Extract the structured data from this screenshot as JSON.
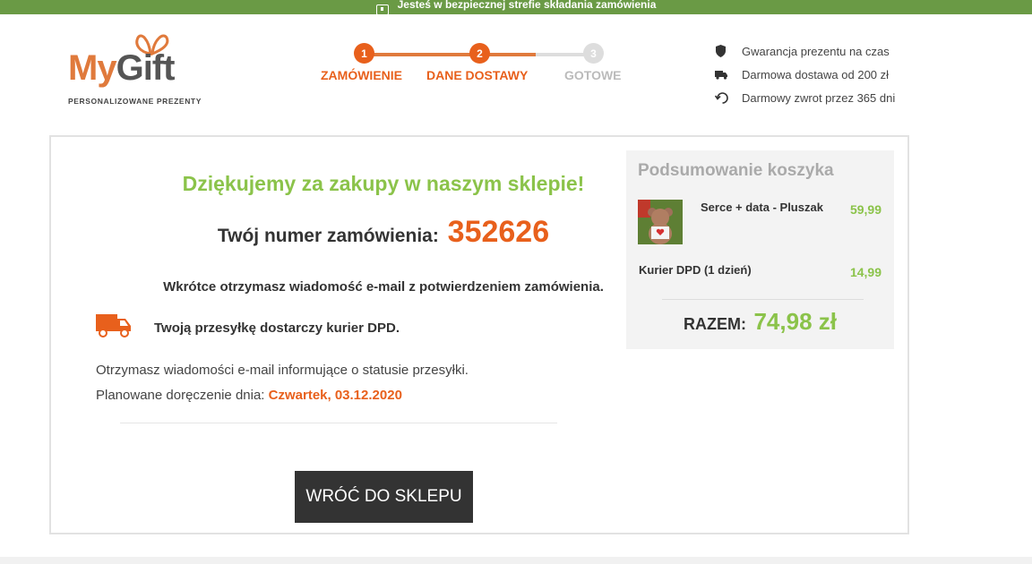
{
  "topbar": {
    "text": "Jesteś w bezpiecznej strefie składania zamówienia"
  },
  "logo": {
    "my": "My",
    "gift": "Gift",
    "tagline": "PERSONALIZOWANE PREZENTY"
  },
  "steps": [
    {
      "number": "1",
      "label": "ZAMÓWIENIE",
      "state": "active"
    },
    {
      "number": "2",
      "label": "DANE DOSTAWY",
      "state": "active"
    },
    {
      "number": "3",
      "label": "GOTOWE",
      "state": "inactive"
    }
  ],
  "benefits": [
    {
      "icon": "shield-icon",
      "text": "Gwarancja prezentu na czas"
    },
    {
      "icon": "truck-icon",
      "text": "Darmowa dostawa od 200 zł"
    },
    {
      "icon": "return-icon",
      "text": "Darmowy zwrot przez 365 dni"
    }
  ],
  "confirmation": {
    "thanks": "Dziękujemy za zakupy w naszym sklepie!",
    "order_label": "Twój numer zamówienia:",
    "order_number": "352626",
    "email_msg": "Wkrótce otrzymasz wiadomość e-mail z potwierdzeniem zamówienia.",
    "courier_msg": "Twoją przesyłkę dostarczy kurier DPD.",
    "status_msg": "Otrzymasz wiadomości e-mail informujące o statusie przesyłki.",
    "delivery_label": "Planowane doręczenie dnia:",
    "delivery_date": "Czwartek, 03.12.2020",
    "back_button": "WRÓĆ DO SKLEPU"
  },
  "summary": {
    "title": "Podsumowanie koszyka",
    "product_name": "Serce + data - Pluszak",
    "product_price": "59,99",
    "courier_name": "Kurier DPD (1 dzień)",
    "courier_price": "14,99",
    "total_label": "RAZEM:",
    "total_value": "74,98 zł"
  },
  "colors": {
    "accent": "#e8601c",
    "green": "#8bc34a",
    "topbar": "#6a9a45",
    "button": "#333333"
  }
}
